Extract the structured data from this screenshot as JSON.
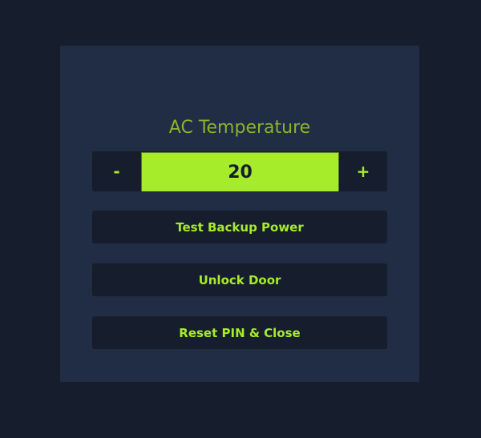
{
  "panel": {
    "title": "AC Temperature"
  },
  "temperature": {
    "decrement_label": "-",
    "value": "20",
    "increment_label": "+"
  },
  "actions": {
    "backup_label": "Test Backup Power",
    "unlock_label": "Unlock Door",
    "reset_label": "Reset PIN & Close"
  },
  "colors": {
    "page_background": "#161d2c",
    "panel_background": "#212c45",
    "accent": "#a6ec2b",
    "title_color": "#8ab42c"
  }
}
